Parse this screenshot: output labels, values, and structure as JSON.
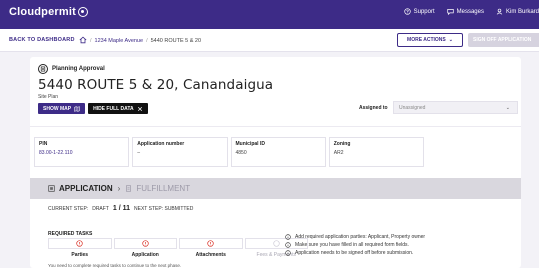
{
  "topbar": {
    "brand": "Cloudpermit",
    "nav": [
      {
        "label": "Support",
        "icon": "help-circle-icon"
      },
      {
        "label": "Messages",
        "icon": "message-icon"
      },
      {
        "label": "Kim Burkard",
        "icon": "user-icon"
      }
    ]
  },
  "breadcrumb": {
    "back_label": "BACK TO DASHBOARD",
    "items": [
      "1234 Maple Avenue",
      "5440 ROUTE 5 & 20"
    ],
    "more_actions_label": "MORE ACTIONS",
    "signoff_label": "SIGN OFF APPLICATION"
  },
  "permit": {
    "type": "Planning Approval",
    "title": "5440 ROUTE 5 & 20, Canandaigua",
    "subtitle": "Site Plan",
    "show_map_label": "SHOW MAP",
    "hide_data_label": "HIDE FULL DATA",
    "assigned_label": "Assigned to",
    "assigned_value": "Unassigned"
  },
  "info": [
    {
      "label": "PIN",
      "value": "83.00-1-22.110"
    },
    {
      "label": "Application number",
      "value": "–"
    },
    {
      "label": "Municipal ID",
      "value": "4850"
    },
    {
      "label": "Zoning",
      "value": "AR2"
    }
  ],
  "tabs": {
    "application": "APPLICATION",
    "fulfillment": "FULFILLMENT"
  },
  "step": {
    "current_label": "CURRENT STEP:",
    "current_value": "DRAFT",
    "count": "1 / 11",
    "next_label": "NEXT STEP: SUBMITTED"
  },
  "required": {
    "title": "REQUIRED TASKS",
    "tasks": [
      {
        "label": "Parties",
        "status": "error"
      },
      {
        "label": "Application",
        "status": "error"
      },
      {
        "label": "Attachments",
        "status": "error"
      },
      {
        "label": "Fees & Payments",
        "status": "pending"
      }
    ],
    "hints": [
      "Add required application parties: Applicant, Property owner",
      "Make sure you have filled in all required form fields.",
      "Application needs to be signed off before submission."
    ],
    "footnote": "You need to complete required tasks to continue to the next phase."
  },
  "colors": {
    "brand": "#3d2b87",
    "error": "#d93025",
    "strip": "#d9d7de"
  }
}
